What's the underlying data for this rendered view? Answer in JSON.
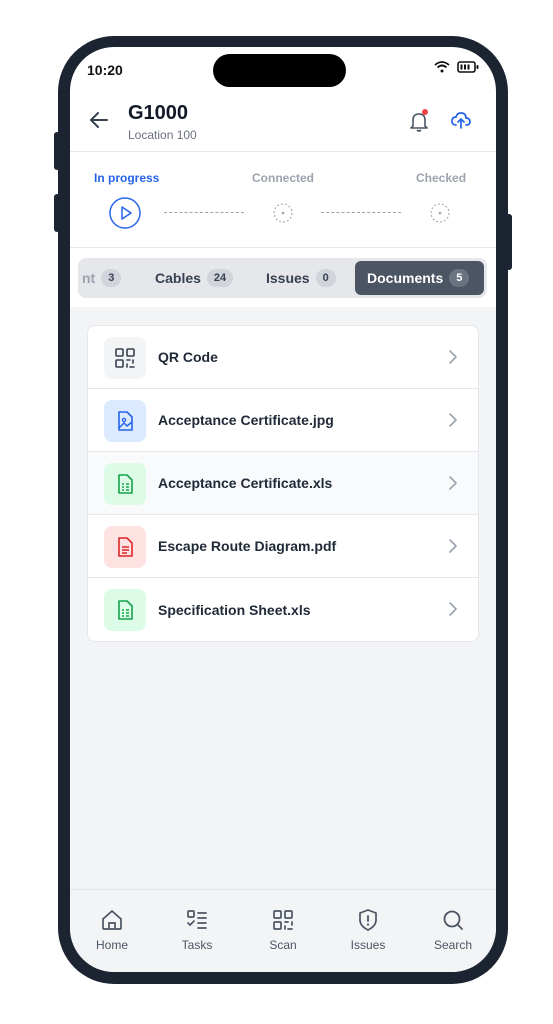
{
  "status": {
    "time": "10:20"
  },
  "header": {
    "title": "G1000",
    "subtitle": "Location 100"
  },
  "progress": {
    "steps": [
      {
        "label": "In progress"
      },
      {
        "label": "Connected"
      },
      {
        "label": "Checked"
      }
    ]
  },
  "tabs": [
    {
      "label": "nt",
      "count": "3"
    },
    {
      "label": "Cables",
      "count": "24"
    },
    {
      "label": "Issues",
      "count": "0"
    },
    {
      "label": "Documents",
      "count": "5"
    }
  ],
  "documents": [
    {
      "label": "QR Code",
      "icon": "qr-code-icon"
    },
    {
      "label": "Acceptance Certificate.jpg",
      "icon": "image-file-icon"
    },
    {
      "label": "Acceptance Certificate.xls",
      "icon": "spreadsheet-file-icon"
    },
    {
      "label": "Escape Route Diagram.pdf",
      "icon": "pdf-file-icon"
    },
    {
      "label": "Specification Sheet.xls",
      "icon": "spreadsheet-file-icon"
    }
  ],
  "nav": [
    {
      "label": "Home",
      "icon": "home-icon"
    },
    {
      "label": "Tasks",
      "icon": "tasks-icon"
    },
    {
      "label": "Scan",
      "icon": "scan-icon"
    },
    {
      "label": "Issues",
      "icon": "issues-icon"
    },
    {
      "label": "Search",
      "icon": "search-icon"
    }
  ],
  "colors": {
    "accent": "#2563eb",
    "alert": "#ef4444",
    "frame": "#1c2432"
  }
}
